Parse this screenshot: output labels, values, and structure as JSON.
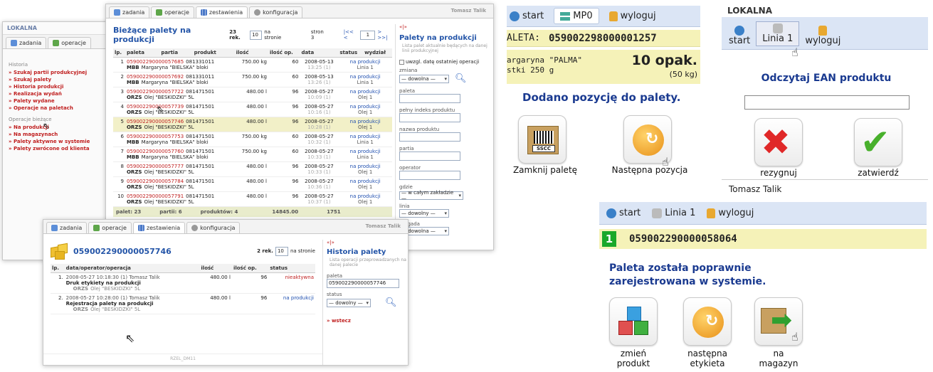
{
  "shot1": {
    "title": "LOKALNA",
    "user": "Tomasz Talik",
    "tabs": [
      "zadania",
      "operacje",
      "zestawienia",
      "konfiguracja"
    ],
    "sidebar": {
      "section1_title": "Historia",
      "section1_items": [
        "» Szukaj partii produkcyjnej",
        "» Szukaj palety",
        "» Historia produkcji",
        "» Realizacja wydań",
        "» Palety wydane",
        "» Operacje na paletach"
      ],
      "section2_title": "Operacje bieżące",
      "section2_items": [
        "» Na produkcji",
        "» Na magazynach",
        "» Palety aktywne w systemie",
        "» Palety zwrócone od klienta"
      ]
    },
    "main": {
      "heading": "Bieżące palety na produkcji",
      "per_page_prefix": "23 rek.",
      "per_page_value": "10",
      "per_page_suffix": "na stronie",
      "page_label": "stron 3",
      "pager": "|<<  <",
      "page_value": "1",
      "pager_next": ">  >>|",
      "columns": [
        "lp.",
        "paleta",
        "partia",
        "produkt",
        "ilość",
        "ilość op.",
        "data",
        "status",
        "wydział"
      ],
      "rows": [
        {
          "lp": "1",
          "code": "059002290000057685",
          "partia": "081331011",
          "brand": "MBB",
          "product": "Margaryna \"BIELSKA\" bloki",
          "qty": "750.00 kg",
          "op": "60",
          "date": "2008-05-13",
          "time": "13:25 (1)",
          "status": "na produkcji",
          "dept": "Linia 1"
        },
        {
          "lp": "2",
          "code": "059002290000057692",
          "partia": "081331011",
          "brand": "MBB",
          "product": "Margaryna \"BIELSKA\" bloki",
          "qty": "750.00 kg",
          "op": "60",
          "date": "2008-05-13",
          "time": "13:26 (1)",
          "status": "na produkcji",
          "dept": "Linia 1"
        },
        {
          "lp": "3",
          "code": "059002290000057722",
          "partia": "081471501",
          "brand": "ORZS",
          "product": "Olej \"BESKIDZKI\" 5L",
          "qty": "480.00 l",
          "op": "96",
          "date": "2008-05-27",
          "time": "10:09 (1)",
          "status": "na produkcji",
          "dept": "Olej 1"
        },
        {
          "lp": "4",
          "code": "059002290000057739",
          "partia": "081471501",
          "brand": "ORZS",
          "product": "Olej \"BESKIDZKI\" 5L",
          "qty": "480.00 l",
          "op": "96",
          "date": "2008-05-27",
          "time": "10:16 (1)",
          "status": "na produkcji",
          "dept": "Olej 1"
        },
        {
          "lp": "5",
          "code": "059002290000057746",
          "partia": "081471501",
          "brand": "ORZS",
          "product": "Olej \"BESKIDZKI\" 5L",
          "qty": "480.00 l",
          "op": "96",
          "date": "2008-05-27",
          "time": "10:28 (1)",
          "status": "na produkcji",
          "dept": "Olej 1"
        },
        {
          "lp": "6",
          "code": "059002290000057753",
          "partia": "081471501",
          "brand": "MBB",
          "product": "Margaryna \"BIELSKA\" bloki",
          "qty": "750.00 kg",
          "op": "60",
          "date": "2008-05-27",
          "time": "10:32 (1)",
          "status": "na produkcji",
          "dept": "Linia 1"
        },
        {
          "lp": "7",
          "code": "059002290000057760",
          "partia": "081471501",
          "brand": "MBB",
          "product": "Margaryna \"BIELSKA\" bloki",
          "qty": "750.00 kg",
          "op": "60",
          "date": "2008-05-27",
          "time": "10:33 (1)",
          "status": "na produkcji",
          "dept": "Linia 1"
        },
        {
          "lp": "8",
          "code": "059002290000057777",
          "partia": "081471501",
          "brand": "ORZS",
          "product": "Olej \"BESKIDZKI\" 5L",
          "qty": "480.00 l",
          "op": "96",
          "date": "2008-05-27",
          "time": "10:33 (1)",
          "status": "na produkcji",
          "dept": "Olej 1"
        },
        {
          "lp": "9",
          "code": "059002290000057784",
          "partia": "081471501",
          "brand": "ORZS",
          "product": "Olej \"BESKIDZKI\" 5L",
          "qty": "480.00 l",
          "op": "96",
          "date": "2008-05-27",
          "time": "10:36 (1)",
          "status": "na produkcji",
          "dept": "Olej 1"
        },
        {
          "lp": "10",
          "code": "059002290000057791",
          "partia": "081471501",
          "brand": "ORZS",
          "product": "Olej \"BESKIDZKI\" 5L",
          "qty": "480.00 l",
          "op": "96",
          "date": "2008-05-27",
          "time": "10:37 (1)",
          "status": "na produkcji",
          "dept": "Olej 1"
        }
      ],
      "footer_pal": "palet: 23",
      "footer_partii": "partii: 6",
      "footer_prod": "produktów: 4",
      "footer_sum": "14845.00",
      "footer_op": "1751"
    },
    "filter": {
      "collapse": "«|»",
      "title": "Palety na produkcji",
      "desc": "Lista palet aktualnie będących na danej linii produkcyjnej",
      "checkbox_label": "uwzgl. datę ostatniej operacji",
      "zmiana_label": "zmiana",
      "zmiana_value": "— dowolna —",
      "paleta_label": "paleta",
      "indeks_label": "pełny indeks produktu",
      "nazwa_label": "nazwa produktu",
      "partia_label": "partia",
      "operator_label": "operator",
      "gdzie_label": "gdzie",
      "gdzie_value": "— w całym zakładzie —",
      "linia_label": "linia",
      "linia_value": "— dowolny —",
      "brygada_label": "brygada",
      "brygada_value": "— dowolna —",
      "last_value": "— dowolny —"
    }
  },
  "shot2": {
    "user": "Tomasz Talik",
    "tabs": [
      "zadania",
      "operacje",
      "zestawienia",
      "konfiguracja"
    ],
    "pallet_code": "059002290000057746",
    "per_page_prefix": "2 rek.",
    "per_page_value": "10",
    "per_page_suffix": "na stronie",
    "columns": [
      "lp.",
      "data/operator/operacja",
      "ilość",
      "ilość op.",
      "status"
    ],
    "rows": [
      {
        "lp": "1.",
        "meta": "2008-05-27 10:18:30 (1) Tomasz Talik",
        "op": "Druk etykiety na produkcji",
        "prod_brand": "ORZS",
        "prod": "Olej \"BESKIDZKI\" 5L",
        "qty": "480.00 l",
        "opq": "96",
        "status": "nieaktywna"
      },
      {
        "lp": "2.",
        "meta": "2008-05-27 10:28:00 (1) Tomasz Talik",
        "op": "Rejestracja palety na produkcji",
        "prod_brand": "ORZS",
        "prod": "Olej \"BESKIDZKI\" 5L",
        "qty": "480.00 l",
        "opq": "96",
        "status": "na produkcji"
      }
    ],
    "footer": "RZEL_DM11",
    "filter": {
      "collapse": "«|»",
      "title": "Historia palety",
      "desc": "Lista operacji przeprowadzanych na danej palecie",
      "paleta_label": "paleta",
      "paleta_value": "059002290000057746",
      "status_label": "status",
      "status_value": "— dowolny —",
      "back": "» wstecz"
    }
  },
  "kiosk1": {
    "nav_start": "start",
    "nav_mp": "MP0",
    "nav_logout": "wyloguj",
    "paleta_label": "ALETA:",
    "paleta_code": "059002298000001257",
    "product_line1": "argaryna \"PALMA\"",
    "product_line2": "stki 250 g",
    "count": "10 opak.",
    "weight": "(50 kg)",
    "message": "Dodano pozycję do palety.",
    "btn_close": "Zamknij paletę",
    "btn_next": "Następna pozycja"
  },
  "kiosk2": {
    "title": "LOKALNA",
    "nav_start": "start",
    "nav_line": "Linia 1",
    "nav_logout": "wyloguj",
    "heading": "Odczytaj EAN produktu",
    "ean_value": "",
    "btn_cancel": "rezygnuj",
    "btn_ok": "zatwierdź",
    "user": "Tomasz Talik"
  },
  "kiosk3": {
    "nav_start": "start",
    "nav_line": "Linia 1",
    "nav_logout": "wyloguj",
    "badge": "1",
    "code": "059002290000058064",
    "message1": "Paleta została poprawnie",
    "message2": "zarejestrowana w systemie.",
    "btn1_line1": "zmień",
    "btn1_line2": "produkt",
    "btn2_line1": "następna",
    "btn2_line2": "etykieta",
    "btn3_line1": "na",
    "btn3_line2": "magazyn"
  }
}
